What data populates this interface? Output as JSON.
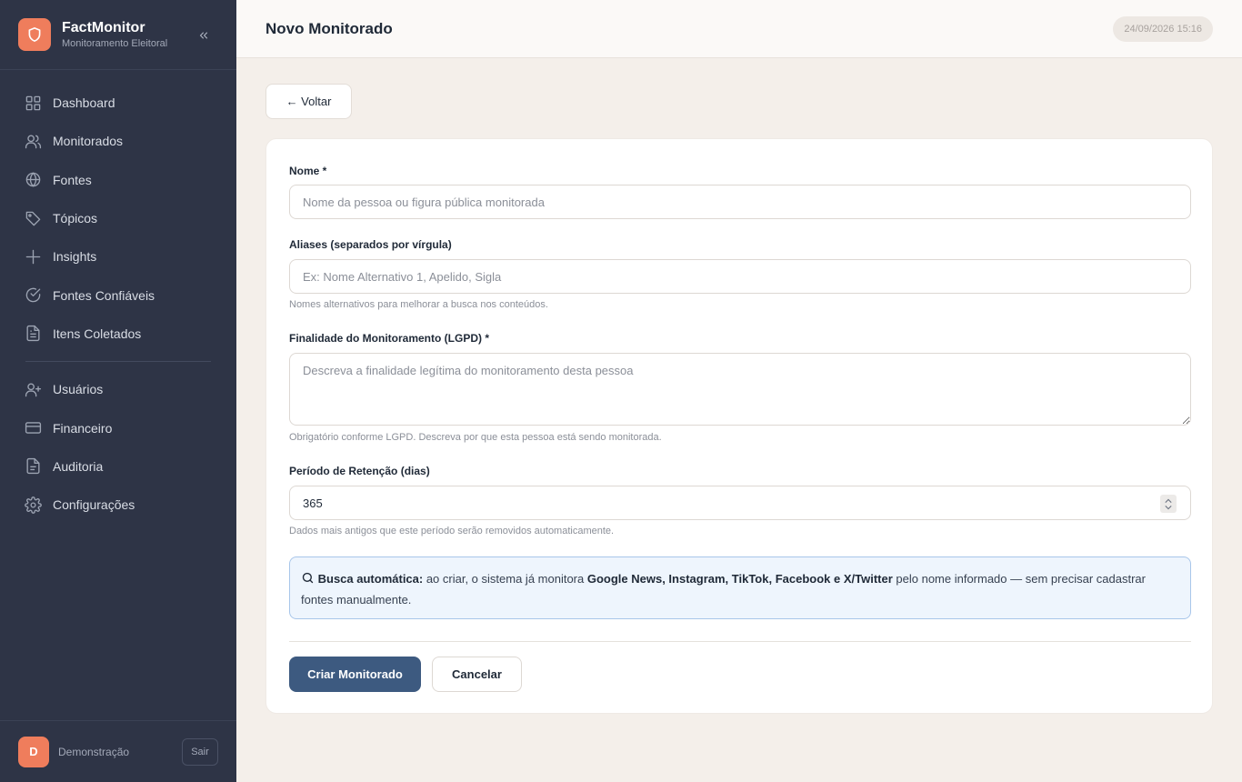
{
  "brand": {
    "name": "FactMonitor",
    "subtitle": "Monitoramento Eleitoral",
    "accent_color": "#ef7d5c"
  },
  "sidebar": {
    "items": [
      {
        "label": "Dashboard",
        "icon": "grid-icon"
      },
      {
        "label": "Monitorados",
        "icon": "users-icon"
      },
      {
        "label": "Fontes",
        "icon": "globe-icon"
      },
      {
        "label": "Tópicos",
        "icon": "tag-icon"
      },
      {
        "label": "Insights",
        "icon": "plus-icon"
      },
      {
        "label": "Fontes Confiáveis",
        "icon": "check-circle-icon"
      },
      {
        "label": "Itens Coletados",
        "icon": "document-icon"
      }
    ],
    "admin_items": [
      {
        "label": "Usuários",
        "icon": "user-plus-icon"
      },
      {
        "label": "Financeiro",
        "icon": "credit-card-icon"
      },
      {
        "label": "Auditoria",
        "icon": "clipboard-icon"
      },
      {
        "label": "Configurações",
        "icon": "gear-icon"
      }
    ]
  },
  "user": {
    "initial": "D",
    "name": "Demonstração",
    "logout_label": "Sair"
  },
  "header": {
    "title": "Novo Monitorado",
    "timestamp": "24/09/2026 15:16"
  },
  "back_label": "← Voltar",
  "form": {
    "name_label": "Nome *",
    "name_placeholder": "Nome da pessoa ou figura pública monitorada",
    "name_value": "",
    "aliases_label": "Aliases (separados por vírgula)",
    "aliases_placeholder": "Ex: Nome Alternativo 1, Apelido, Sigla",
    "aliases_value": "",
    "aliases_hint": "Nomes alternativos para melhorar a busca nos conteúdos.",
    "purpose_label": "Finalidade do Monitoramento (LGPD) *",
    "purpose_placeholder": "Descreva a finalidade legítima do monitoramento desta pessoa",
    "purpose_value": "",
    "purpose_hint": "Obrigatório conforme LGPD. Descreva por que esta pessoa está sendo monitorada.",
    "retention_label": "Período de Retenção (dias)",
    "retention_value": "365",
    "retention_hint": "Dados mais antigos que este período serão removidos automaticamente."
  },
  "info": {
    "title": "Busca automática:",
    "text_before": " ao criar, o sistema já monitora ",
    "platforms": "Google News, Instagram, TikTok, Facebook e X/Twitter",
    "text_after": " pelo nome informado — sem precisar cadastrar fontes manualmente."
  },
  "actions": {
    "submit_label": "Criar Monitorado",
    "cancel_label": "Cancelar",
    "primary_color": "#3d5a80"
  }
}
